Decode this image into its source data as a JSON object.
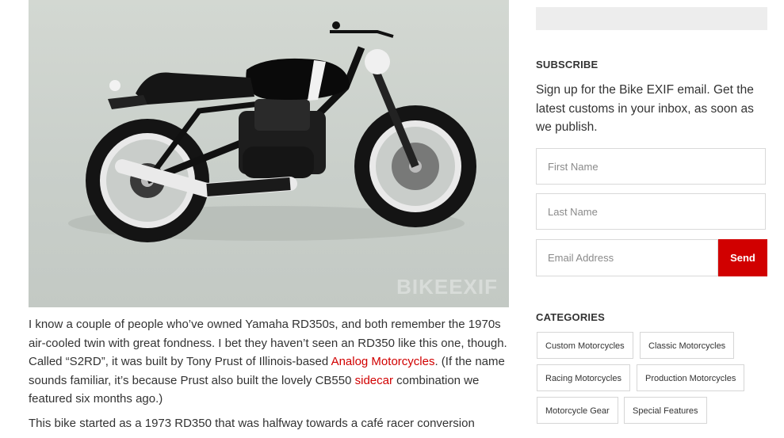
{
  "hero": {
    "watermark": "BIKEEXIF"
  },
  "article": {
    "p1_part1": "I know a couple of people who’ve owned Yamaha RD350s, and both remember the 1970s air-cooled twin with great fondness. I bet they haven’t seen an RD350 like this one, though. Called “S2RD”, it was built by Tony Prust of Illinois-based ",
    "p1_link1": "Analog Motorcycles",
    "p1_part2": ". (If the name sounds familiar, it’s because Prust also built the lovely CB550 ",
    "p1_link2": "sidecar",
    "p1_part3": " combination we featured six months ago.)",
    "p2": "This bike started as a 1973 RD350 that was halfway towards a café racer conversion"
  },
  "subscribe": {
    "heading": "SUBSCRIBE",
    "text": "Sign up for the Bike EXIF email. Get the latest customs in your inbox, as soon as we publish.",
    "first_name_placeholder": "First Name",
    "last_name_placeholder": "Last Name",
    "email_placeholder": "Email Address",
    "send_label": "Send"
  },
  "categories": {
    "heading": "CATEGORIES",
    "items": [
      "Custom Motorcycles",
      "Classic Motorcycles",
      "Racing Motorcycles",
      "Production Motorcycles",
      "Motorcycle Gear",
      "Special Features"
    ]
  },
  "colors": {
    "accent": "#d10000"
  }
}
